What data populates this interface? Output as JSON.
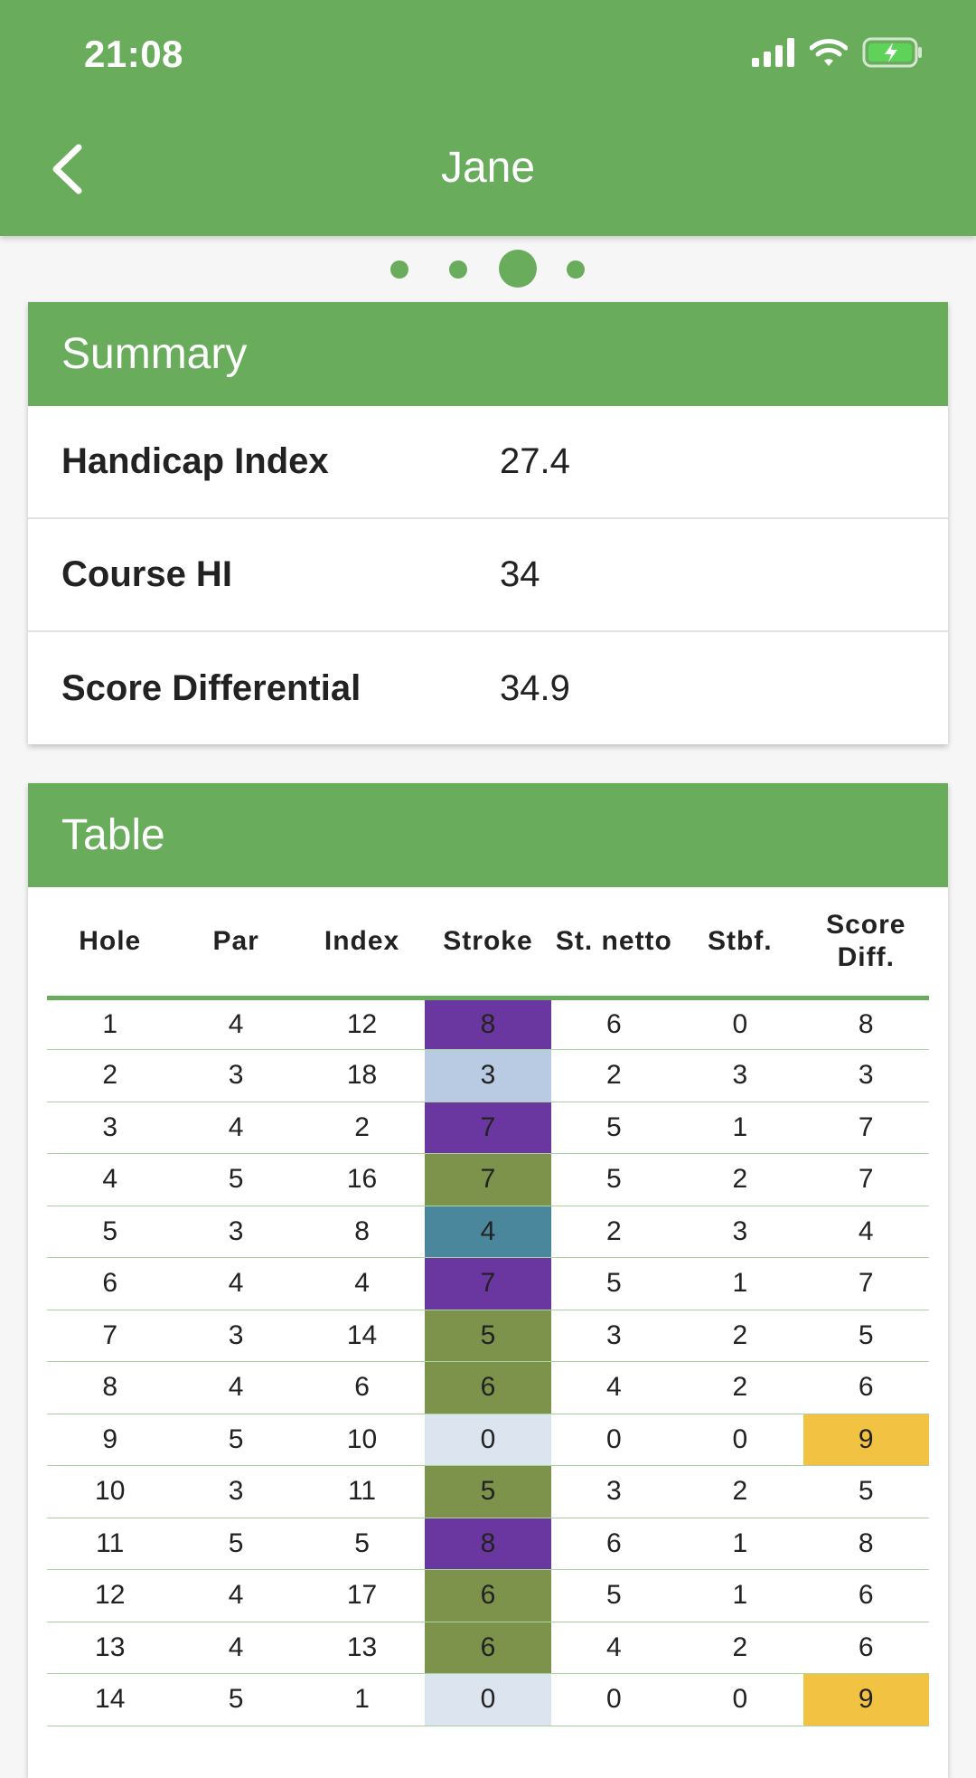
{
  "status_bar": {
    "time": "21:08"
  },
  "header": {
    "title": "Jane"
  },
  "pager": {
    "count": 4,
    "active": 3
  },
  "summary": {
    "title": "Summary",
    "rows": [
      {
        "label": "Handicap Index",
        "value": "27.4"
      },
      {
        "label": "Course HI",
        "value": "34"
      },
      {
        "label": "Score Differential",
        "value": "34.9"
      }
    ]
  },
  "table": {
    "title": "Table",
    "columns": [
      "Hole",
      "Par",
      "Index",
      "Stroke",
      "St. netto",
      "Stbf.",
      "Score Diff."
    ],
    "rows": [
      {
        "hole": "1",
        "par": "4",
        "index": "12",
        "stroke": "8",
        "netto": "6",
        "stbf": "0",
        "diff": "8"
      },
      {
        "hole": "2",
        "par": "3",
        "index": "18",
        "stroke": "3",
        "netto": "2",
        "stbf": "3",
        "diff": "3"
      },
      {
        "hole": "3",
        "par": "4",
        "index": "2",
        "stroke": "7",
        "netto": "5",
        "stbf": "1",
        "diff": "7"
      },
      {
        "hole": "4",
        "par": "5",
        "index": "16",
        "stroke": "7",
        "netto": "5",
        "stbf": "2",
        "diff": "7"
      },
      {
        "hole": "5",
        "par": "3",
        "index": "8",
        "stroke": "4",
        "netto": "2",
        "stbf": "3",
        "diff": "4"
      },
      {
        "hole": "6",
        "par": "4",
        "index": "4",
        "stroke": "7",
        "netto": "5",
        "stbf": "1",
        "diff": "7"
      },
      {
        "hole": "7",
        "par": "3",
        "index": "14",
        "stroke": "5",
        "netto": "3",
        "stbf": "2",
        "diff": "5"
      },
      {
        "hole": "8",
        "par": "4",
        "index": "6",
        "stroke": "6",
        "netto": "4",
        "stbf": "2",
        "diff": "6"
      },
      {
        "hole": "9",
        "par": "5",
        "index": "10",
        "stroke": "0",
        "netto": "0",
        "stbf": "0",
        "diff": "9"
      },
      {
        "hole": "10",
        "par": "3",
        "index": "11",
        "stroke": "5",
        "netto": "3",
        "stbf": "2",
        "diff": "5"
      },
      {
        "hole": "11",
        "par": "5",
        "index": "5",
        "stroke": "8",
        "netto": "6",
        "stbf": "1",
        "diff": "8"
      },
      {
        "hole": "12",
        "par": "4",
        "index": "17",
        "stroke": "6",
        "netto": "5",
        "stbf": "1",
        "diff": "6"
      },
      {
        "hole": "13",
        "par": "4",
        "index": "13",
        "stroke": "6",
        "netto": "4",
        "stbf": "2",
        "diff": "6"
      },
      {
        "hole": "14",
        "par": "5",
        "index": "1",
        "stroke": "0",
        "netto": "0",
        "stbf": "0",
        "diff": "9"
      }
    ]
  },
  "stroke_colors": {
    "triple_bogey_plus": "#6a37a0",
    "birdie": "#7f7f7f",
    "double_bogey": "#7d924a",
    "bogey": "#4a879c",
    "par": "#b8cbe2",
    "not_played": "#dce4ef"
  },
  "diff_highlight_color": "#f2c343",
  "theme": {
    "primary": "#69ad5c",
    "divider": "#a9d39f"
  }
}
